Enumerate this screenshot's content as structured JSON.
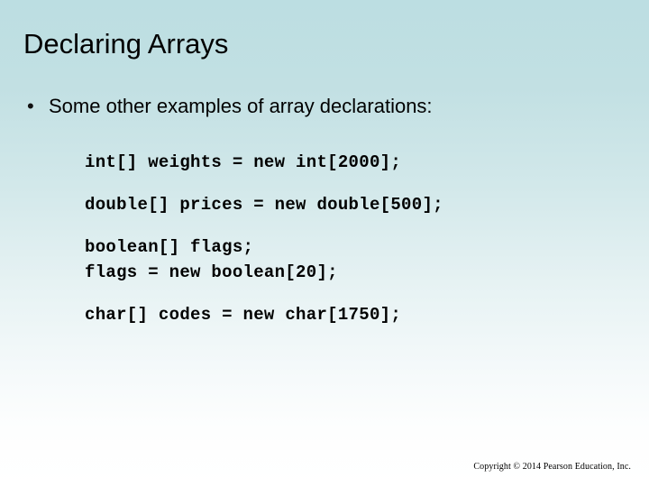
{
  "slide": {
    "title": "Declaring Arrays",
    "background_top_color": "#bcdee2",
    "background_bottom_color": "#ffffff",
    "text_color": "#000000"
  },
  "bullet": {
    "marker": "•",
    "text": "Some other examples of array declarations:"
  },
  "code_blocks": [
    {
      "lines": [
        "int[] weights = new int[2000];"
      ]
    },
    {
      "lines": [
        "double[] prices = new double[500];"
      ]
    },
    {
      "lines": [
        "boolean[] flags;",
        "flags = new boolean[20];"
      ]
    },
    {
      "lines": [
        "char[] codes = new char[1750];"
      ]
    }
  ],
  "footer": {
    "copyright": "Copyright © 2014 Pearson Education, Inc."
  }
}
